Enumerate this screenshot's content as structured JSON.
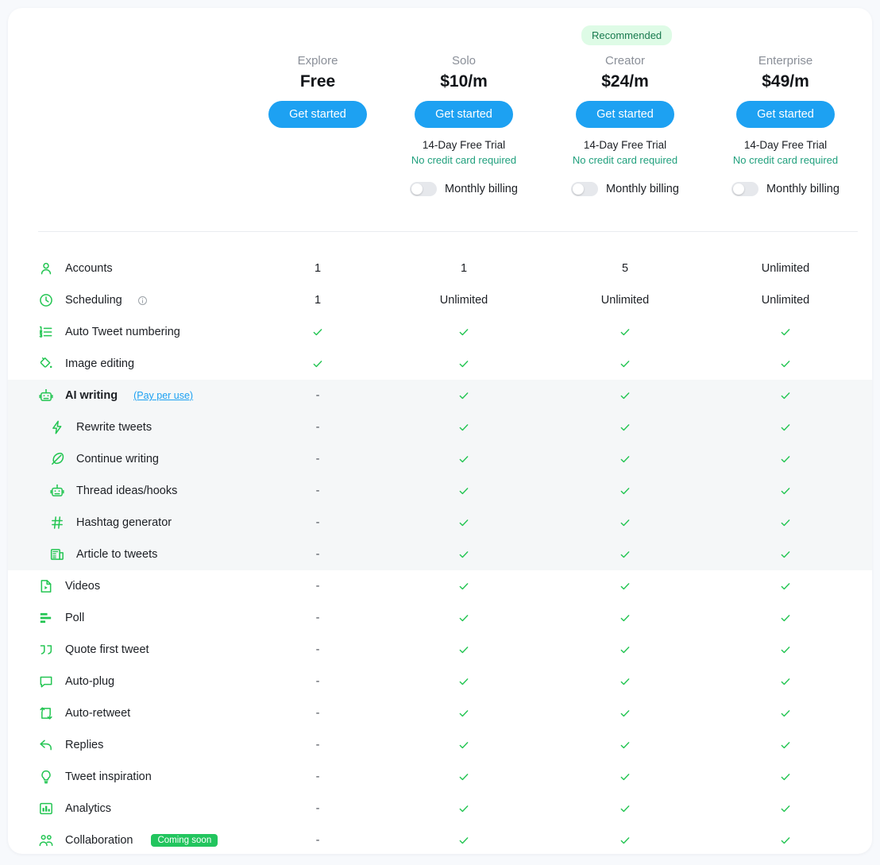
{
  "recommended_badge": "Recommended",
  "plans": [
    {
      "name": "Explore",
      "price": "Free",
      "cta": "Get started",
      "trial": "",
      "nocard": "",
      "billing_label": "",
      "has_trial": false
    },
    {
      "name": "Solo",
      "price": "$10/m",
      "cta": "Get started",
      "trial": "14-Day Free Trial",
      "nocard": "No credit card required",
      "billing_label": "Monthly billing",
      "has_trial": true
    },
    {
      "name": "Creator",
      "price": "$24/m",
      "cta": "Get started",
      "trial": "14-Day Free Trial",
      "nocard": "No credit card required",
      "billing_label": "Monthly billing",
      "has_trial": true
    },
    {
      "name": "Enterprise",
      "price": "$49/m",
      "cta": "Get started",
      "trial": "14-Day Free Trial",
      "nocard": "No credit card required",
      "billing_label": "Monthly billing",
      "has_trial": true
    }
  ],
  "features": [
    {
      "icon": "user-icon",
      "label": "Accounts",
      "sub": false,
      "highlight": false,
      "bold": false,
      "info": false,
      "values": [
        "1",
        "1",
        "5",
        "Unlimited"
      ]
    },
    {
      "icon": "clock-icon",
      "label": "Scheduling",
      "sub": false,
      "highlight": false,
      "bold": false,
      "info": true,
      "values": [
        "1",
        "Unlimited",
        "Unlimited",
        "Unlimited"
      ]
    },
    {
      "icon": "numbered-list-icon",
      "label": "Auto Tweet numbering",
      "sub": false,
      "highlight": false,
      "bold": false,
      "info": false,
      "values": [
        "check",
        "check",
        "check",
        "check"
      ]
    },
    {
      "icon": "paint-bucket-icon",
      "label": "Image editing",
      "sub": false,
      "highlight": false,
      "bold": false,
      "info": false,
      "values": [
        "check",
        "check",
        "check",
        "check"
      ]
    },
    {
      "icon": "robot-icon",
      "label": "AI writing",
      "link": "(Pay per use)",
      "sub": false,
      "highlight": true,
      "bold": true,
      "info": false,
      "values": [
        "-",
        "check",
        "check",
        "check"
      ]
    },
    {
      "icon": "bolt-icon",
      "label": "Rewrite tweets",
      "sub": true,
      "highlight": true,
      "bold": false,
      "info": false,
      "values": [
        "-",
        "check",
        "check",
        "check"
      ]
    },
    {
      "icon": "feather-icon",
      "label": "Continue writing",
      "sub": true,
      "highlight": true,
      "bold": false,
      "info": false,
      "values": [
        "-",
        "check",
        "check",
        "check"
      ]
    },
    {
      "icon": "robot-icon",
      "label": "Thread ideas/hooks",
      "sub": true,
      "highlight": true,
      "bold": false,
      "info": false,
      "values": [
        "-",
        "check",
        "check",
        "check"
      ]
    },
    {
      "icon": "hashtag-icon",
      "label": "Hashtag generator",
      "sub": true,
      "highlight": true,
      "bold": false,
      "info": false,
      "values": [
        "-",
        "check",
        "check",
        "check"
      ]
    },
    {
      "icon": "article-icon",
      "label": "Article to tweets",
      "sub": true,
      "highlight": true,
      "bold": false,
      "info": false,
      "values": [
        "-",
        "check",
        "check",
        "check"
      ]
    },
    {
      "icon": "video-icon",
      "label": "Videos",
      "sub": false,
      "highlight": false,
      "bold": false,
      "info": false,
      "values": [
        "-",
        "check",
        "check",
        "check"
      ]
    },
    {
      "icon": "poll-icon",
      "label": "Poll",
      "sub": false,
      "highlight": false,
      "bold": false,
      "info": false,
      "values": [
        "-",
        "check",
        "check",
        "check"
      ]
    },
    {
      "icon": "quote-icon",
      "label": "Quote first tweet",
      "sub": false,
      "highlight": false,
      "bold": false,
      "info": false,
      "values": [
        "-",
        "check",
        "check",
        "check"
      ]
    },
    {
      "icon": "comment-icon",
      "label": "Auto-plug",
      "sub": false,
      "highlight": false,
      "bold": false,
      "info": false,
      "values": [
        "-",
        "check",
        "check",
        "check"
      ]
    },
    {
      "icon": "retweet-icon",
      "label": "Auto-retweet",
      "sub": false,
      "highlight": false,
      "bold": false,
      "info": false,
      "values": [
        "-",
        "check",
        "check",
        "check"
      ]
    },
    {
      "icon": "reply-icon",
      "label": "Replies",
      "sub": false,
      "highlight": false,
      "bold": false,
      "info": false,
      "values": [
        "-",
        "check",
        "check",
        "check"
      ]
    },
    {
      "icon": "lightbulb-icon",
      "label": "Tweet inspiration",
      "sub": false,
      "highlight": false,
      "bold": false,
      "info": false,
      "values": [
        "-",
        "check",
        "check",
        "check"
      ]
    },
    {
      "icon": "bar-chart-icon",
      "label": "Analytics",
      "sub": false,
      "highlight": false,
      "bold": false,
      "info": false,
      "values": [
        "-",
        "check",
        "check",
        "check"
      ]
    },
    {
      "icon": "people-icon",
      "label": "Collaboration",
      "badge": "Coming soon",
      "sub": false,
      "highlight": false,
      "bold": false,
      "info": false,
      "values": [
        "-",
        "check",
        "check",
        "check"
      ]
    }
  ],
  "colors": {
    "accent": "#1da1f2",
    "green": "#23c552",
    "badge_bg": "#defbe6",
    "badge_text": "#18794e",
    "soon_bg": "#22c55e",
    "teal": "#20a07d"
  }
}
